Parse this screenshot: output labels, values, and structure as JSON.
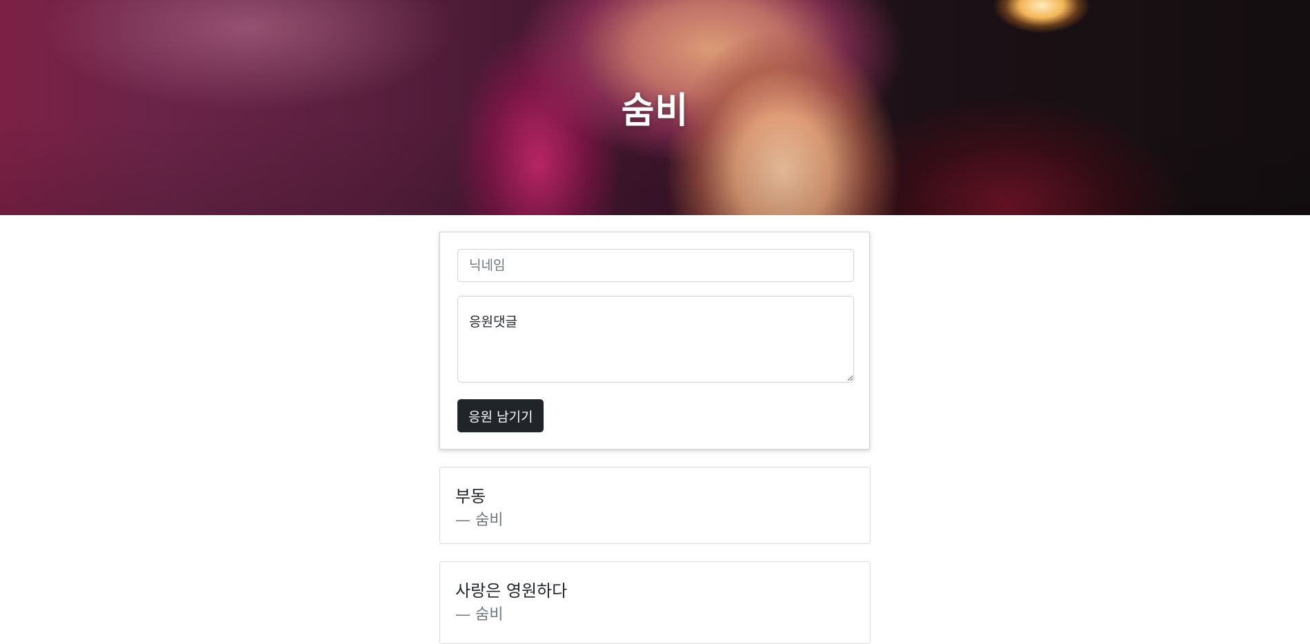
{
  "hero": {
    "title": "숨비"
  },
  "form": {
    "nickname_placeholder": "닉네임",
    "comment_placeholder": "응원댓글",
    "submit_label": "응원 남기기"
  },
  "comments": [
    {
      "text": "부동",
      "author": "— 숨비"
    },
    {
      "text": "사랑은 영원하다",
      "author": "— 숨비"
    }
  ],
  "colors": {
    "button_bg": "#212529",
    "author_text": "#6c757d",
    "border": "#ced4da"
  }
}
